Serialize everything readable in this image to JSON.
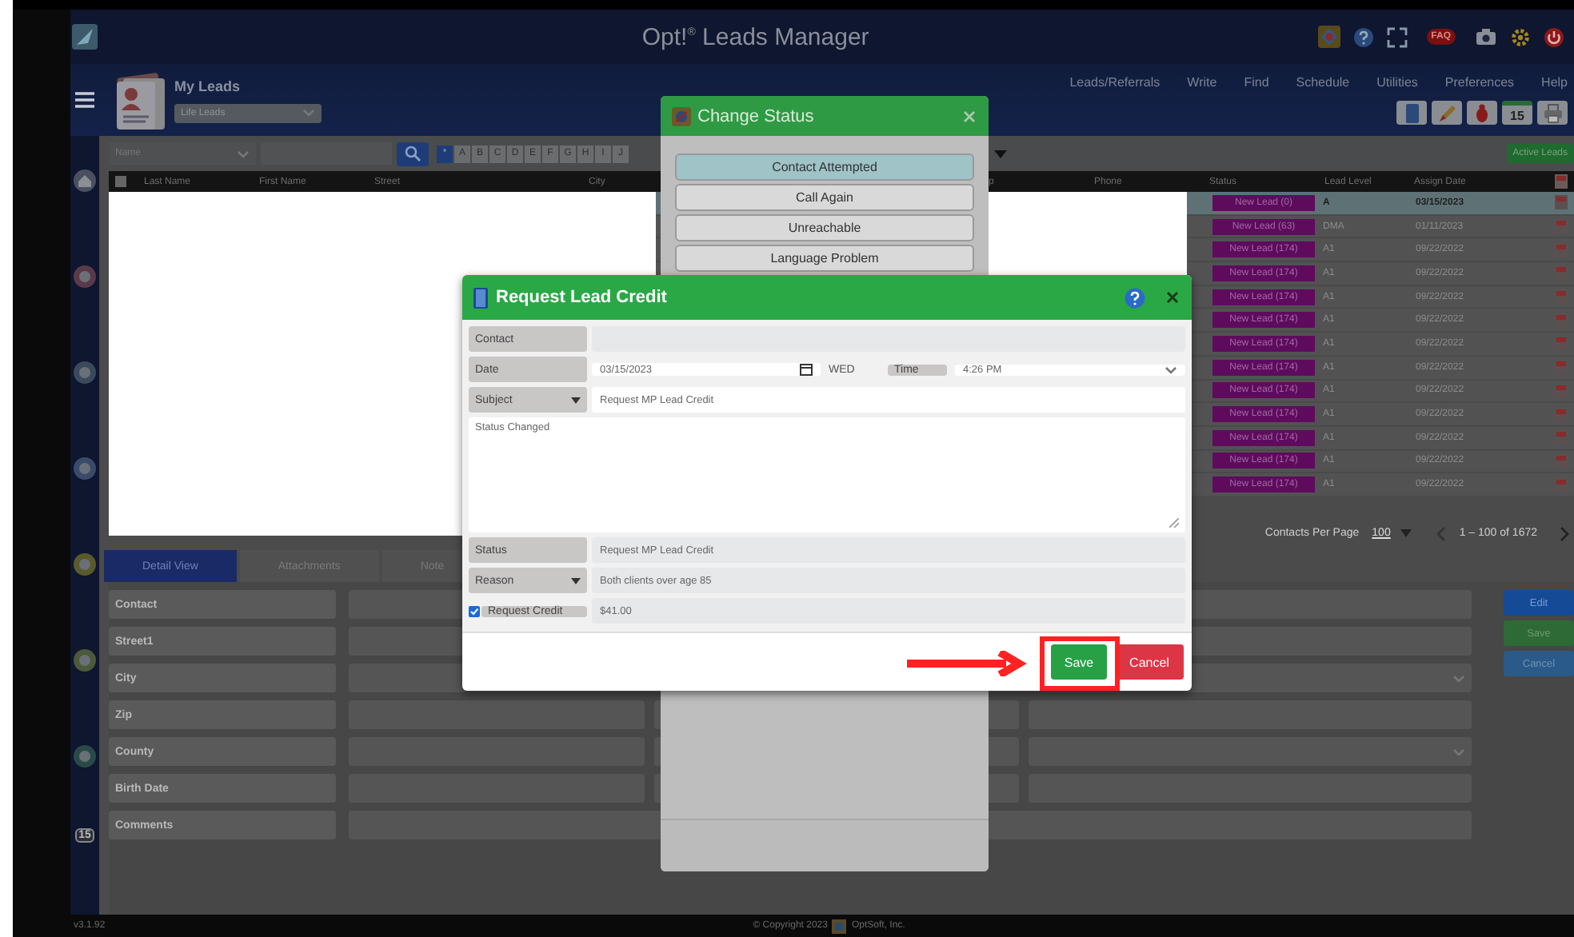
{
  "app": {
    "title": "Opt!$^{®}$ Leads Manager",
    "faq_badge": "FAQ"
  },
  "view": {
    "title": "My Leads",
    "list": "Life Leads"
  },
  "menu": [
    "Leads/Referrals",
    "Write",
    "Find",
    "Schedule",
    "Utilities",
    "Preferences",
    "Help"
  ],
  "toolbar": {
    "calendar_day": "15"
  },
  "filter": {
    "field": "Name",
    "active_button": "Active Leads",
    "letters": [
      {
        "label": "*",
        "selected": true
      },
      {
        "label": "A",
        "selected": false
      },
      {
        "label": "B",
        "selected": false
      },
      {
        "label": "C",
        "selected": false
      },
      {
        "label": "D",
        "selected": false
      },
      {
        "label": "E",
        "selected": false
      },
      {
        "label": "F",
        "selected": false
      },
      {
        "label": "G",
        "selected": false
      },
      {
        "label": "H",
        "selected": false
      },
      {
        "label": "I",
        "selected": false
      },
      {
        "label": "J",
        "selected": false
      }
    ]
  },
  "table": {
    "select_all_checked": false,
    "columns": [
      "Last Name",
      "First Name",
      "Street",
      "City",
      "p",
      "Phone",
      "Status",
      "Lead Level",
      "Assign Date"
    ],
    "rows": [
      {
        "status": "New Lead (0)",
        "lead_level": "A",
        "assign_date": "03/15/2023",
        "selected": true
      },
      {
        "status": "New Lead (63)",
        "lead_level": "DMA",
        "assign_date": "01/11/2023",
        "selected": false
      },
      {
        "status": "New Lead (174)",
        "lead_level": "A1",
        "assign_date": "09/22/2022",
        "selected": false
      },
      {
        "status": "New Lead (174)",
        "lead_level": "A1",
        "assign_date": "09/22/2022",
        "selected": false
      },
      {
        "status": "New Lead (174)",
        "lead_level": "A1",
        "assign_date": "09/22/2022",
        "selected": false
      },
      {
        "status": "New Lead (174)",
        "lead_level": "A1",
        "assign_date": "09/22/2022",
        "selected": false
      },
      {
        "status": "New Lead (174)",
        "lead_level": "A1",
        "assign_date": "09/22/2022",
        "selected": false
      },
      {
        "status": "New Lead (174)",
        "lead_level": "A1",
        "assign_date": "09/22/2022",
        "selected": false
      },
      {
        "status": "New Lead (174)",
        "lead_level": "A1",
        "assign_date": "09/22/2022",
        "selected": false
      },
      {
        "status": "New Lead (174)",
        "lead_level": "A1",
        "assign_date": "09/22/2022",
        "selected": false
      },
      {
        "status": "New Lead (174)",
        "lead_level": "A1",
        "assign_date": "09/22/2022",
        "selected": false
      },
      {
        "status": "New Lead (174)",
        "lead_level": "A1",
        "assign_date": "09/22/2022",
        "selected": false
      },
      {
        "status": "New Lead (174)",
        "lead_level": "A1",
        "assign_date": "09/22/2022",
        "selected": false
      }
    ]
  },
  "pager": {
    "label": "Contacts Per Page",
    "per_page": "100",
    "range": "1 – 100 of 1672"
  },
  "detail": {
    "tabs": [
      {
        "label": "Detail View",
        "selected": true
      },
      {
        "label": "Attachments",
        "selected": false
      },
      {
        "label": "Note",
        "selected": false
      }
    ],
    "fields": [
      {
        "label": "Contact",
        "kind": "text"
      },
      {
        "label": "Street1",
        "kind": "text"
      },
      {
        "label": "City",
        "kind": "select"
      },
      {
        "label": "Zip",
        "kind": "split"
      },
      {
        "label": "County",
        "kind": "split-select"
      },
      {
        "label": "Birth Date",
        "kind": "split"
      },
      {
        "label": "Comments",
        "kind": "text"
      }
    ],
    "buttons": [
      "Edit",
      "Save",
      "Cancel"
    ]
  },
  "sidebar": {
    "calendar_day": "15"
  },
  "footer": {
    "version": "v3.1.92",
    "copyright": "© Copyright 2023",
    "company": "OptSoft, Inc."
  },
  "change_status": {
    "title": "Change Status",
    "options": [
      {
        "label": "Contact Attempted",
        "selected": true
      },
      {
        "label": "Call Again",
        "selected": false
      },
      {
        "label": "Unreachable",
        "selected": false
      },
      {
        "label": "Language Problem",
        "selected": false
      }
    ]
  },
  "request_credit": {
    "title": "Request Lead Credit",
    "contact": {
      "label": "Contact"
    },
    "date": {
      "label": "Date",
      "value": "03/15/2023",
      "weekday": "WED"
    },
    "time": {
      "label": "Time",
      "value": "4:26 PM"
    },
    "subject": {
      "label": "Subject",
      "value": "Request MP Lead Credit"
    },
    "note": "Status Changed",
    "status": {
      "label": "Status",
      "value": "Request MP Lead Credit"
    },
    "reason": {
      "label": "Reason",
      "value": "Both clients over age 85"
    },
    "request": {
      "label": "Request Credit",
      "checked": true,
      "value": "$41.00"
    },
    "buttons": {
      "save": "Save",
      "cancel": "Cancel"
    },
    "save_highlighted": true
  }
}
